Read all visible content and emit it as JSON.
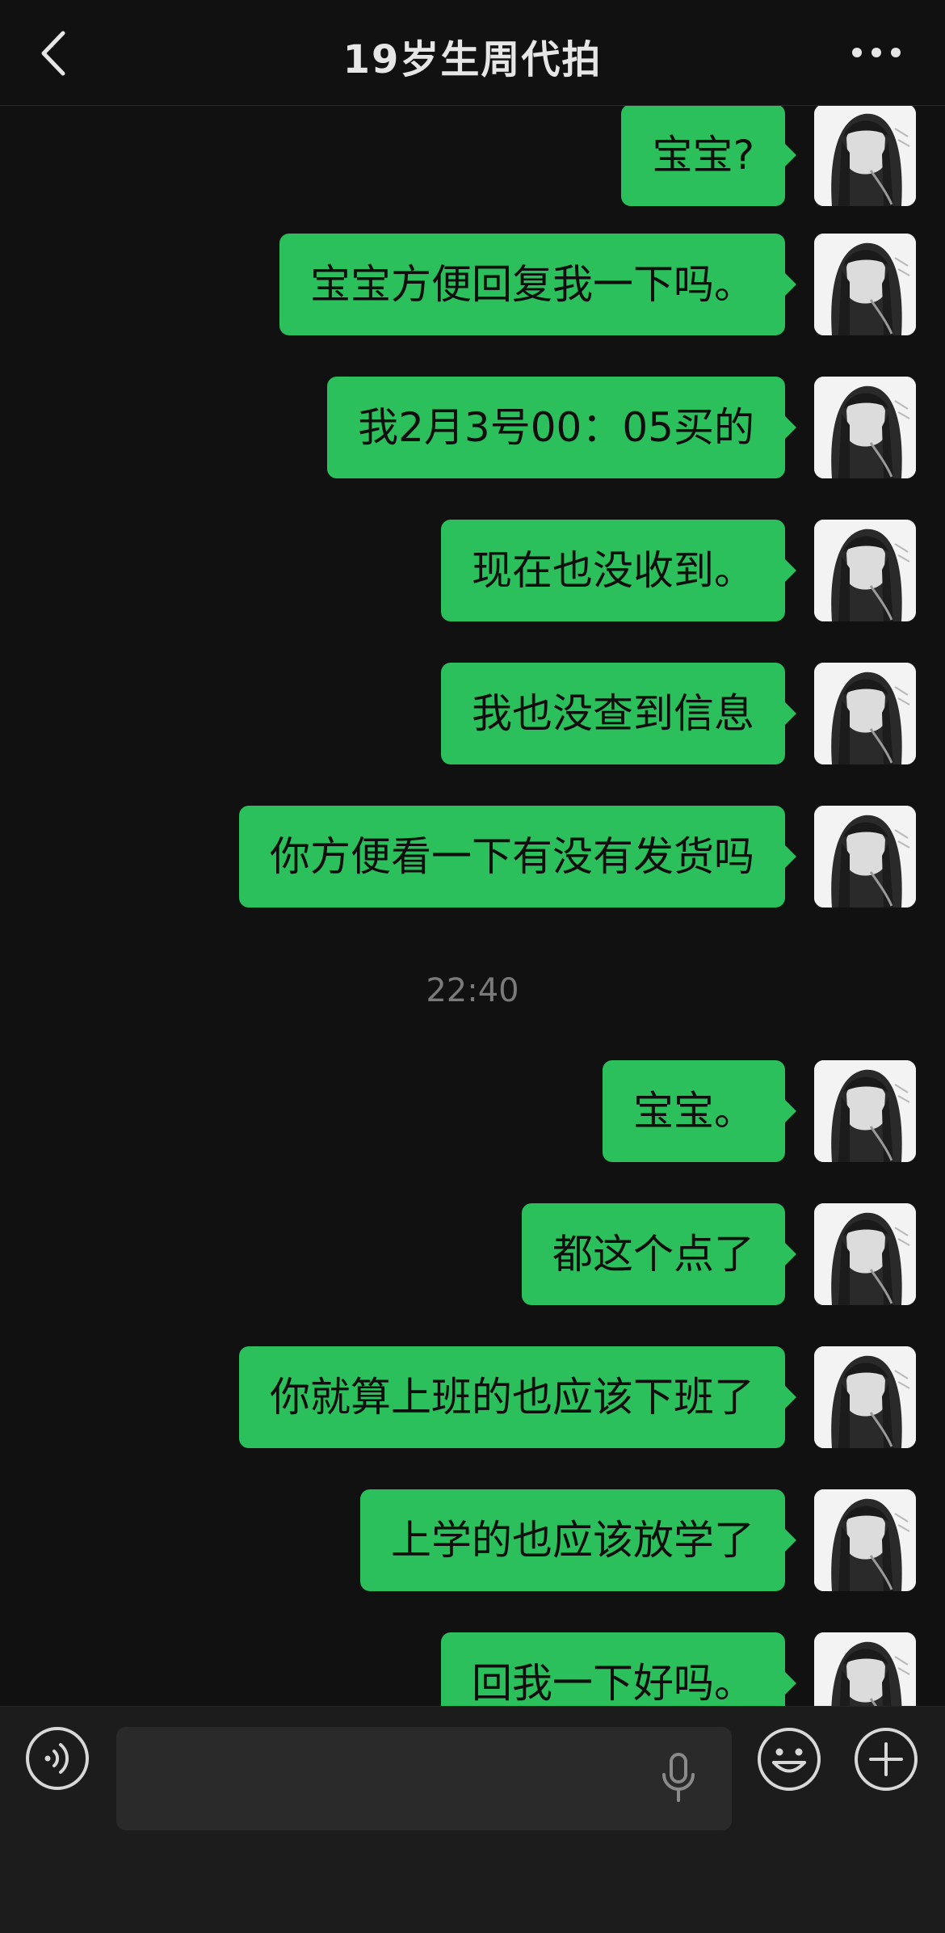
{
  "header": {
    "title": "19岁生周代拍",
    "back_icon": "chevron-left-icon",
    "more_icon": "more-dots-icon"
  },
  "messages": [
    {
      "text": "宝宝?"
    },
    {
      "text": "宝宝方便回复我一下吗。"
    },
    {
      "text": "我2月3号00：05买的"
    },
    {
      "text": "现在也没收到。"
    },
    {
      "text": "我也没查到信息"
    },
    {
      "text": "你方便看一下有没有发货吗"
    },
    {
      "text": "宝宝。"
    },
    {
      "text": "都这个点了"
    },
    {
      "text": "你就算上班的也应该下班了"
    },
    {
      "text": "上学的也应该放学了"
    },
    {
      "text": "回我一下好吗。"
    }
  ],
  "timestamp": "22:40",
  "input": {
    "value": "",
    "voice_icon": "voice-icon",
    "mic_icon": "microphone-icon",
    "emoji_icon": "emoji-icon",
    "plus_icon": "plus-icon"
  },
  "colors": {
    "background": "#111111",
    "bubble": "#2cc05c",
    "input_bar": "#1c1c1c"
  }
}
